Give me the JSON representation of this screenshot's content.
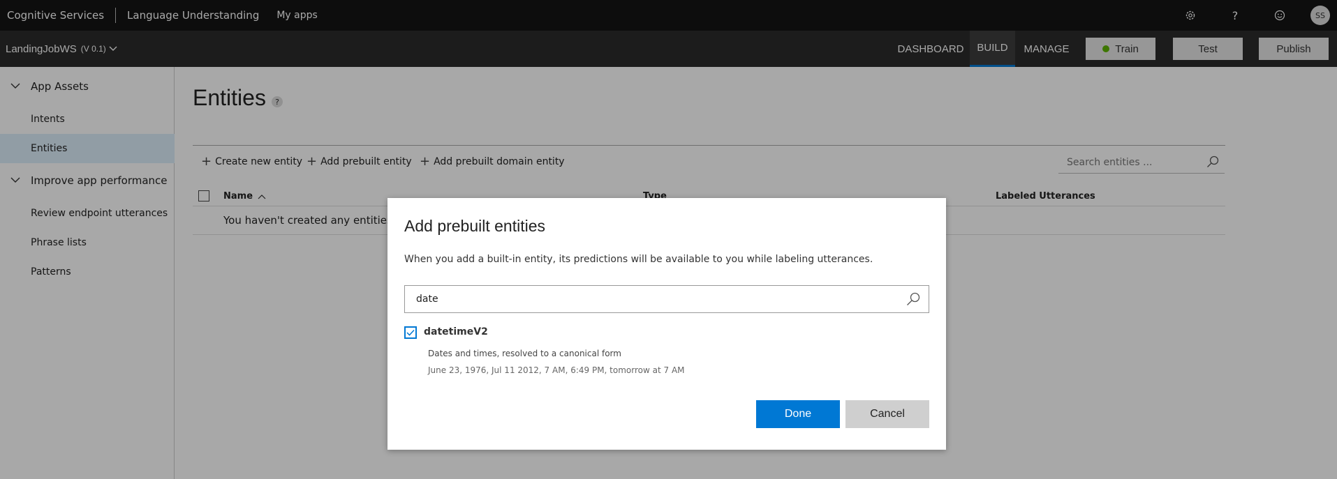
{
  "topbar": {
    "brand": "Cognitive Services",
    "product": "Language Understanding",
    "my_apps": "My apps",
    "avatar": "SS"
  },
  "appbar": {
    "app_name": "LandingJobWS",
    "version": "(V 0.1)",
    "tabs": [
      "DASHBOARD",
      "BUILD",
      "MANAGE"
    ],
    "active_tab": "BUILD",
    "train": "Train",
    "test": "Test",
    "publish": "Publish"
  },
  "sidebar": {
    "section1": "App Assets",
    "section1_items": [
      "Intents",
      "Entities"
    ],
    "section2": "Improve app performance",
    "section2_items": [
      "Review endpoint utterances",
      "Phrase lists",
      "Patterns"
    ],
    "active_item": "Entities"
  },
  "main": {
    "title": "Entities",
    "help": "?",
    "toolbar": {
      "create": "Create new entity",
      "add_prebuilt": "Add prebuilt entity",
      "add_domain": "Add prebuilt domain entity",
      "search_placeholder": "Search entities ..."
    },
    "columns": [
      "Name",
      "Type",
      "Labeled Utterances"
    ],
    "empty_row": "You haven't created any entities ye"
  },
  "dialog": {
    "title": "Add prebuilt entities",
    "description": "When you add a built-in entity, its predictions will be available to you while labeling utterances.",
    "search_value": "date",
    "entity_name": "datetimeV2",
    "entity_checked": true,
    "entity_description": "Dates and times, resolved to a canonical form",
    "entity_examples": "June 23, 1976, Jul 11 2012, 7 AM, 6:49 PM, tomorrow at 7 AM",
    "done": "Done",
    "cancel": "Cancel"
  },
  "colors": {
    "accent": "#0078d4",
    "train_dot": "#5db300"
  }
}
